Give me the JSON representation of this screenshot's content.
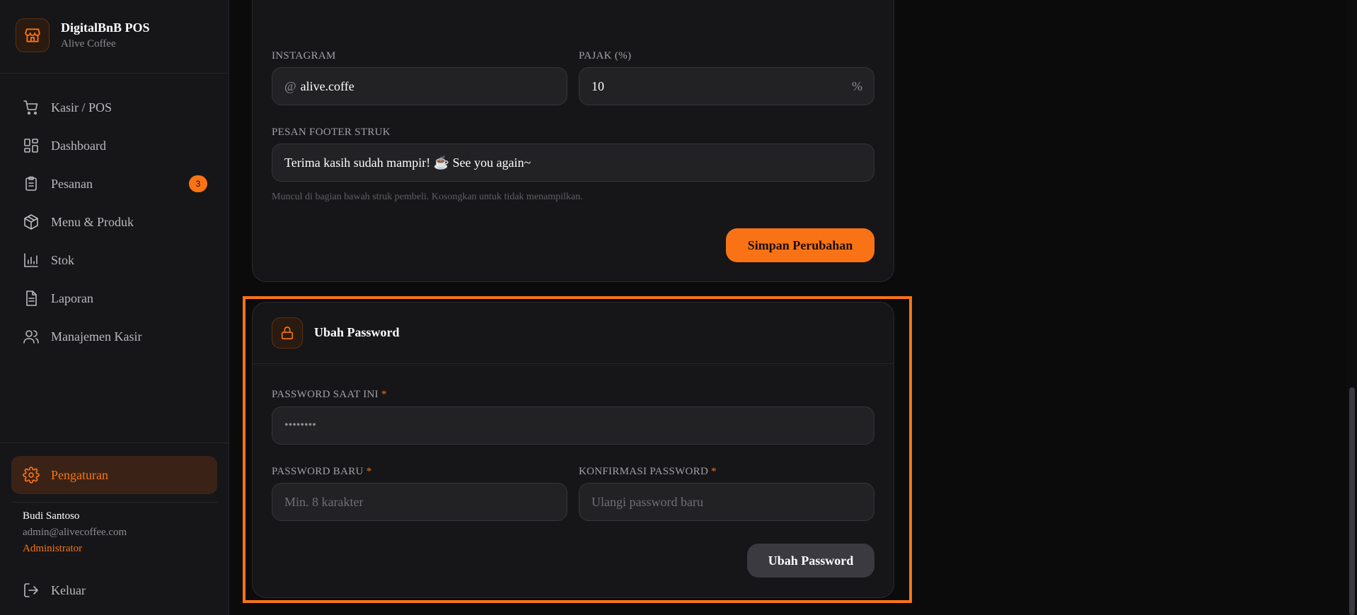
{
  "brand": {
    "title": "DigitalBnB POS",
    "subtitle": "Alive Coffee",
    "icon": "store-icon"
  },
  "nav": {
    "items": [
      {
        "label": "Kasir / POS",
        "icon": "cart-icon"
      },
      {
        "label": "Dashboard",
        "icon": "dashboard-icon"
      },
      {
        "label": "Pesanan",
        "icon": "clipboard-icon",
        "badge": "3"
      },
      {
        "label": "Menu & Produk",
        "icon": "box-icon"
      },
      {
        "label": "Stok",
        "icon": "bar-chart-icon"
      },
      {
        "label": "Laporan",
        "icon": "document-icon"
      },
      {
        "label": "Manajemen Kasir",
        "icon": "users-icon"
      }
    ],
    "settings_label": "Pengaturan",
    "logout_label": "Keluar"
  },
  "user": {
    "name": "Budi Santoso",
    "email": "admin@alivecoffee.com",
    "role": "Administrator"
  },
  "store_form": {
    "instagram_label": "INSTAGRAM",
    "instagram_prefix": "@",
    "instagram_value": "alive.coffe",
    "tax_label": "PAJAK (%)",
    "tax_value": "10",
    "tax_suffix": "%",
    "footer_label": "PESAN FOOTER STRUK",
    "footer_value": "Terima kasih sudah mampir! ☕ See you again~",
    "footer_hint": "Muncul di bagian bawah struk pembeli. Kosongkan untuk tidak menampilkan.",
    "save_label": "Simpan Perubahan"
  },
  "password_form": {
    "title": "Ubah Password",
    "current_label": "PASSWORD SAAT INI",
    "current_value": "••••••••",
    "new_label": "PASSWORD BARU",
    "new_placeholder": "Min. 8 karakter",
    "confirm_label": "KONFIRMASI PASSWORD",
    "confirm_placeholder": "Ulangi password baru",
    "required_mark": "*",
    "submit_label": "Ubah Password"
  },
  "colors": {
    "accent": "#f97316",
    "background": "#0b0b0c",
    "panel": "#161618"
  }
}
